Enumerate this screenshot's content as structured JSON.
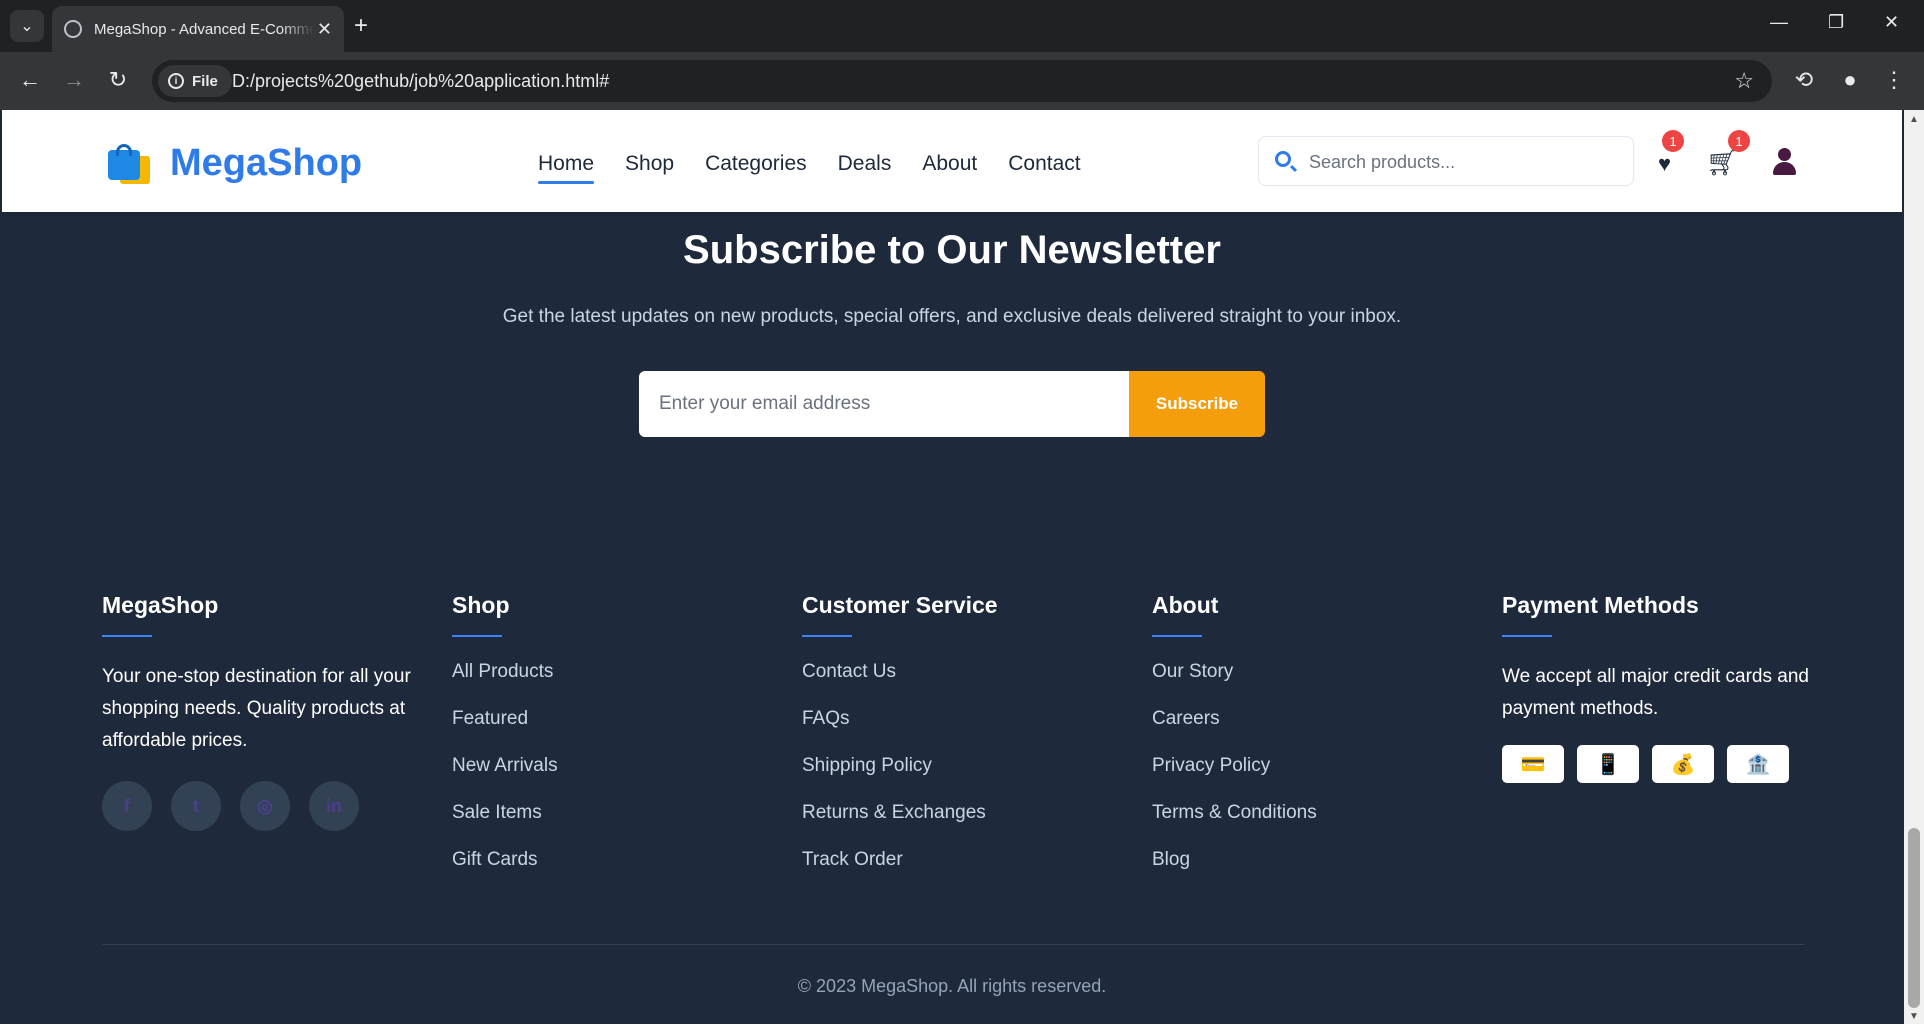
{
  "browser": {
    "tab_title": "MegaShop - Advanced E-Commerce",
    "tab_close": "✕",
    "new_tab": "+",
    "site_chip": "File",
    "url": "D:/projects%20gethub/job%20application.html#"
  },
  "header": {
    "logo_text": "MegaShop",
    "nav": [
      "Home",
      "Shop",
      "Categories",
      "Deals",
      "About",
      "Contact"
    ],
    "active_nav": "Home",
    "search_placeholder": "Search products...",
    "wishlist_count": "1",
    "cart_count": "1",
    "icons": {
      "wishlist": "heart-icon",
      "cart": "cart-icon",
      "account": "user-icon",
      "search": "search-icon"
    }
  },
  "newsletter": {
    "title": "Subscribe to Our Newsletter",
    "subtitle": "Get the latest updates on new products, special offers, and exclusive deals delivered straight to your inbox.",
    "email_placeholder": "Enter your email address",
    "button_label": "Subscribe"
  },
  "footer": {
    "about": {
      "title": "MegaShop",
      "text": "Your one-stop destination for all your shopping needs. Quality products at affordable prices.",
      "socials": [
        "facebook-icon",
        "twitter-icon",
        "instagram-icon",
        "linkedin-icon"
      ]
    },
    "shop": {
      "title": "Shop",
      "links": [
        "All Products",
        "Featured",
        "New Arrivals",
        "Sale Items",
        "Gift Cards"
      ]
    },
    "service": {
      "title": "Customer Service",
      "links": [
        "Contact Us",
        "FAQs",
        "Shipping Policy",
        "Returns & Exchanges",
        "Track Order"
      ]
    },
    "company": {
      "title": "About",
      "links": [
        "Our Story",
        "Careers",
        "Privacy Policy",
        "Terms & Conditions",
        "Blog"
      ]
    },
    "payment": {
      "title": "Payment Methods",
      "text": "We accept all major credit cards and payment methods.",
      "methods": [
        {
          "name": "credit-card-icon",
          "glyph": "💳"
        },
        {
          "name": "mobile-payment-icon",
          "glyph": "📱"
        },
        {
          "name": "money-bag-icon",
          "glyph": "💰"
        },
        {
          "name": "bank-icon",
          "glyph": "🏦"
        }
      ]
    },
    "copyright": "© 2023 MegaShop. All rights reserved."
  },
  "colors": {
    "brand_blue": "#2f7be8",
    "accent_orange": "#f59e0b",
    "footer_bg": "#1e293b",
    "badge_red": "#ef4444"
  }
}
